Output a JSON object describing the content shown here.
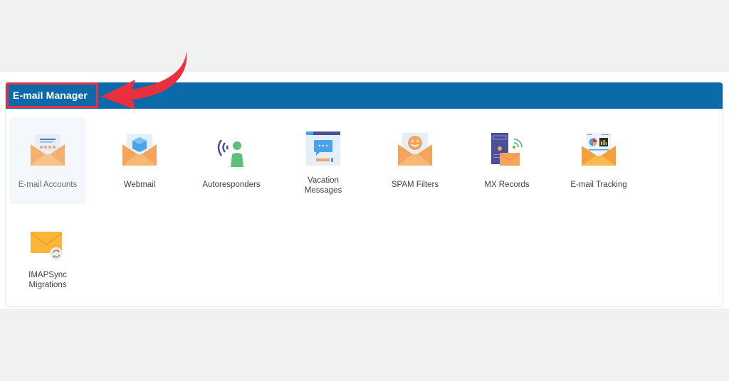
{
  "panel": {
    "title": "E-mail Manager",
    "header_color": "#0d6aaa",
    "annotation_color": "#e8303f"
  },
  "tiles": [
    {
      "label": "E-mail Accounts",
      "icon": "envelope-password-icon",
      "active": true
    },
    {
      "label": "Webmail",
      "icon": "envelope-cube-icon"
    },
    {
      "label": "Autoresponders",
      "icon": "person-broadcast-icon"
    },
    {
      "label_line1": "Vacation",
      "label_line2": "Messages",
      "icon": "window-chat-icon"
    },
    {
      "label": "SPAM Filters",
      "icon": "envelope-smiley-icon"
    },
    {
      "label": "MX Records",
      "icon": "server-envelope-icon"
    },
    {
      "label": "E-mail Tracking",
      "icon": "envelope-chart-icon"
    },
    {
      "label_line1": "IMAPSync",
      "label_line2": "Migrations",
      "icon": "envelope-sync-icon"
    }
  ]
}
